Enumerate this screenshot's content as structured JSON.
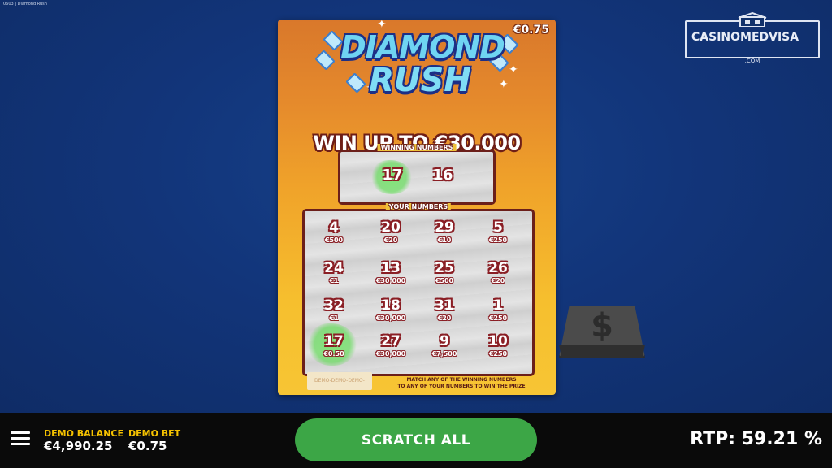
{
  "window_title": "0603 | Diamond Rush",
  "ticket": {
    "logo_line1": "DIAMOND",
    "logo_line2": "RUSH",
    "price": "€0.75",
    "headline": "WIN UP TO €30,000",
    "winning_numbers_label": "WINNING NUMBERS",
    "winning_numbers": [
      "17",
      "16"
    ],
    "your_numbers_label": "YOUR NUMBERS",
    "your_numbers": [
      {
        "number": "4",
        "prize": "€500"
      },
      {
        "number": "20",
        "prize": "€20"
      },
      {
        "number": "29",
        "prize": "€10"
      },
      {
        "number": "5",
        "prize": "€250"
      },
      {
        "number": "24",
        "prize": "€1"
      },
      {
        "number": "13",
        "prize": "€30,000"
      },
      {
        "number": "25",
        "prize": "€500"
      },
      {
        "number": "26",
        "prize": "€20"
      },
      {
        "number": "32",
        "prize": "€1"
      },
      {
        "number": "18",
        "prize": "€30,000"
      },
      {
        "number": "31",
        "prize": "€20"
      },
      {
        "number": "1",
        "prize": "€250"
      },
      {
        "number": "17",
        "prize": "€0.50"
      },
      {
        "number": "27",
        "prize": "€30,000"
      },
      {
        "number": "9",
        "prize": "€7,500"
      },
      {
        "number": "10",
        "prize": "€250"
      }
    ],
    "demo_stamp": "DEMO-DEMO-DEMO-DEMO",
    "instructions_line1": "MATCH ANY OF THE WINNING NUMBERS",
    "instructions_line2": "TO ANY OF YOUR NUMBERS TO WIN THE PRIZE"
  },
  "watermark": {
    "brand": "CASINOMEDVISA",
    "sub": ".COM"
  },
  "scratch_tile_icon": "dollar-icon",
  "bottom_bar": {
    "menu_icon": "hamburger-menu-icon",
    "balance_label": "DEMO BALANCE",
    "balance_value": "€4,990.25",
    "bet_label": "DEMO BET",
    "bet_value": "€0.75",
    "scratch_all_label": "SCRATCH ALL",
    "rtp_text": "RTP: 59.21 %"
  },
  "colors": {
    "background": "#12357a",
    "ticket_orange": "#e58a2c",
    "ticket_yellow": "#f6bf2e",
    "number_outline": "#8a1e24",
    "accent_green": "#3ca646",
    "label_yellow": "#f5c200",
    "match_highlight": "#78e66e"
  }
}
